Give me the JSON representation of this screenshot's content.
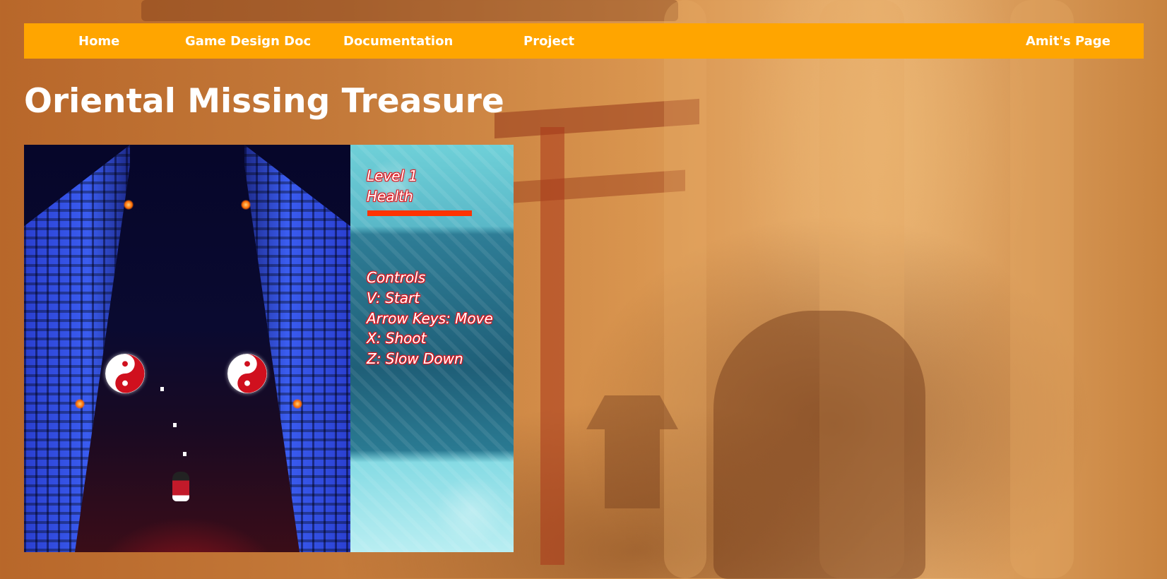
{
  "nav": {
    "home": "Home",
    "game_design_doc": "Game Design Doc",
    "documentation": "Documentation",
    "project": "Project",
    "amits_page": "Amit's Page"
  },
  "page": {
    "title": "Oriental Missing Treasure"
  },
  "game": {
    "level": "Level 1",
    "health_label": "Health",
    "health_fraction": 1.0,
    "controls": {
      "heading": "Controls",
      "start": "V: Start",
      "move": "Arrow Keys: Move",
      "shoot": "X: Shoot",
      "slow": "Z: Slow Down"
    }
  },
  "colors": {
    "navbar": "#ffa500",
    "hud_outline": "#e3141c",
    "health_bar": "#ff3300",
    "yinyang_red": "#d0101e"
  }
}
